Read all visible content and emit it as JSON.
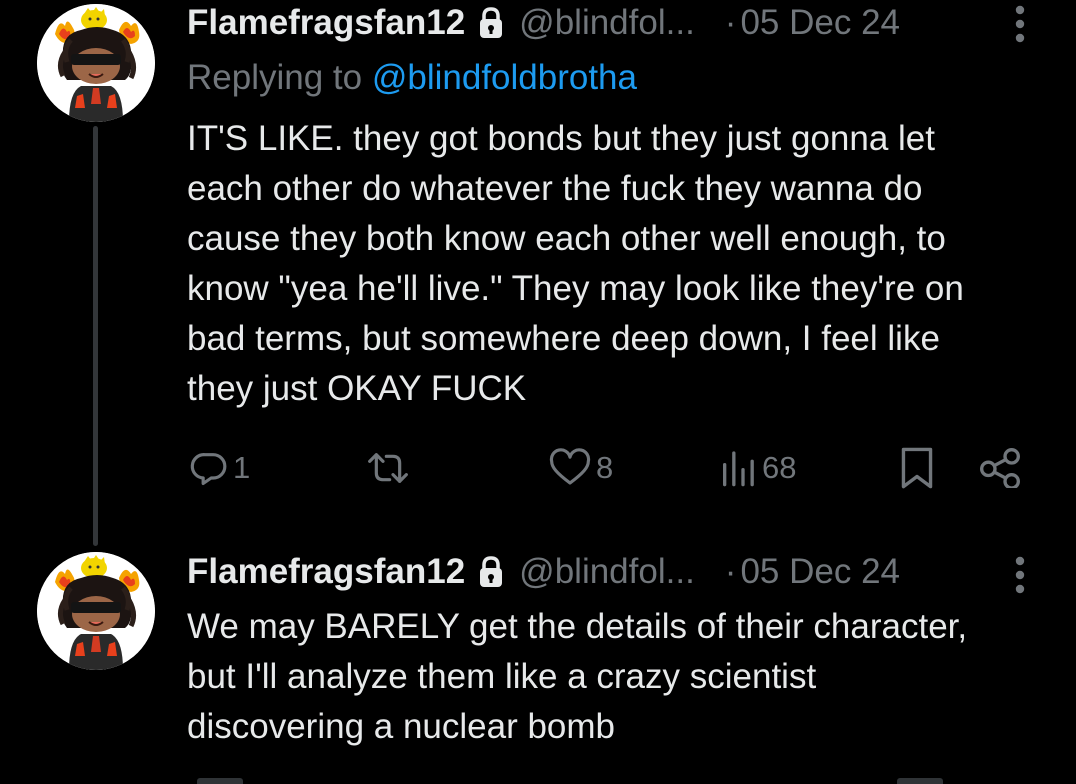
{
  "colors": {
    "background": "#000000",
    "text_primary": "#e7e9ea",
    "text_secondary": "#71767b",
    "mention_link": "#1d9bf0",
    "thread_line": "#333639"
  },
  "tweets": [
    {
      "author": {
        "display_name": "Flamefragsfan12",
        "handle": "@blindfol...",
        "protected_icon": "lock-icon",
        "avatar": "flaming-crowned-character-avatar"
      },
      "separator": "·",
      "date": "05 Dec 24",
      "more_icon": "vertical-ellipsis-icon",
      "reply_to": {
        "prefix": "Replying to",
        "mention": "@blindfoldbrotha"
      },
      "text_lines": [
        "IT'S LIKE. they got bonds but they just gonna let",
        "each other do whatever the fuck they wanna do",
        "cause they both know each other well enough, to",
        "know \"yea he'll live.\" They may look like they're on",
        "bad terms, but somewhere deep down, I feel like",
        "they just OKAY FUCK"
      ],
      "actions": {
        "replies": {
          "icon": "reply-bubble-icon",
          "count": "1"
        },
        "reposts": {
          "icon": "repost-icon",
          "count": ""
        },
        "likes": {
          "icon": "heart-icon",
          "count": "8"
        },
        "views": {
          "icon": "views-bar-chart-icon",
          "count": "68"
        },
        "bookmark": {
          "icon": "bookmark-icon"
        },
        "share": {
          "icon": "share-icon"
        }
      }
    },
    {
      "author": {
        "display_name": "Flamefragsfan12",
        "handle": "@blindfol...",
        "protected_icon": "lock-icon",
        "avatar": "flaming-crowned-character-avatar"
      },
      "separator": "·",
      "date": "05 Dec 24",
      "more_icon": "vertical-ellipsis-icon",
      "text_lines": [
        "We may BARELY get the details of their character,",
        "but I'll analyze them like a crazy scientist",
        "discovering a nuclear bomb"
      ]
    }
  ]
}
